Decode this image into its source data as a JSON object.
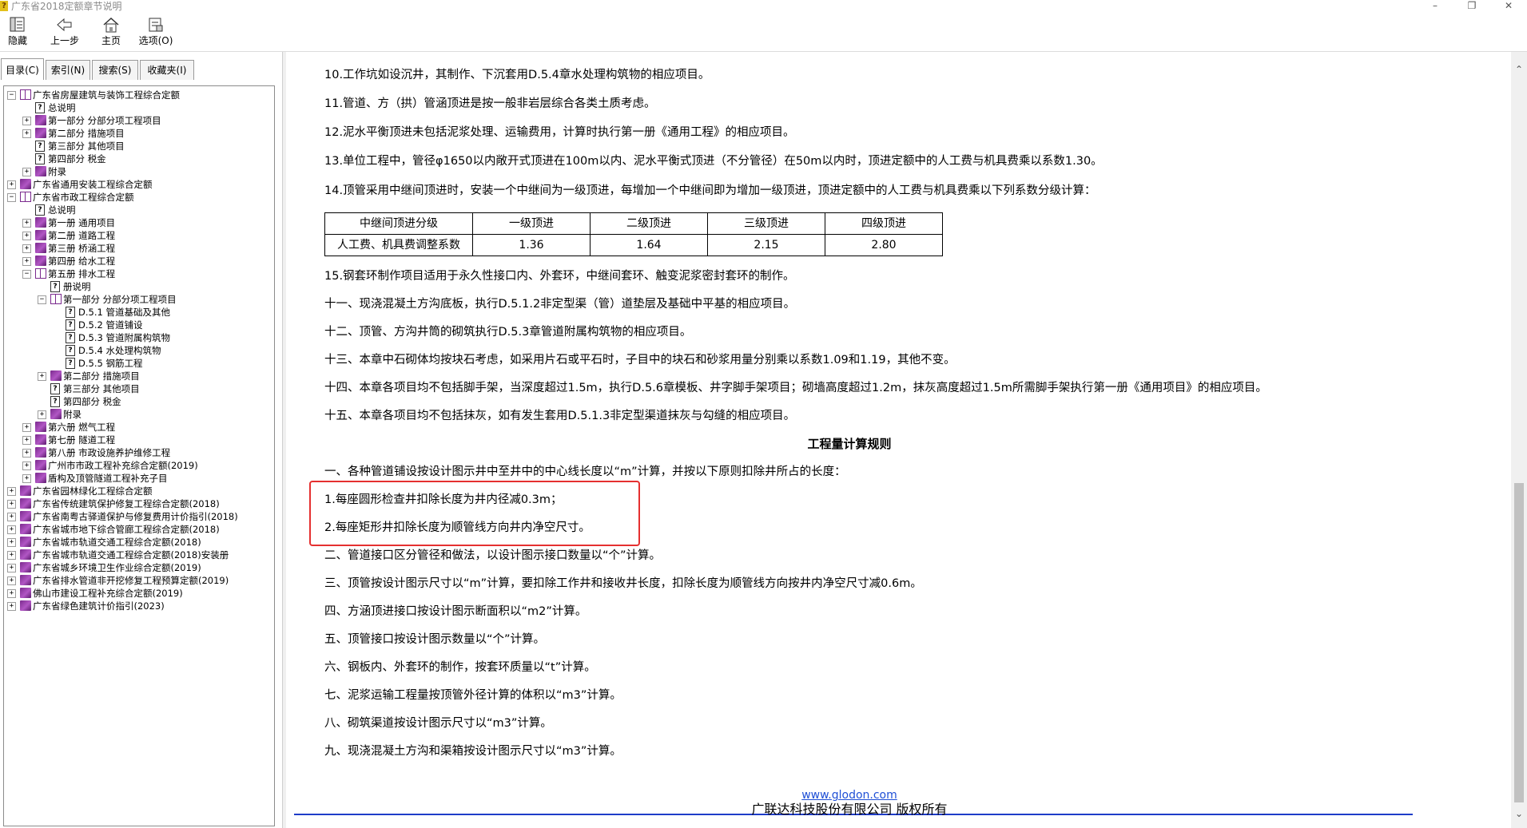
{
  "window": {
    "title": "广东省2018定额章节说明",
    "app_icon": "question-book-icon",
    "buttons": {
      "minimize": "–",
      "maximize": "❐",
      "close": "✕"
    }
  },
  "toolbar": {
    "items": [
      {
        "label": "隐藏",
        "icon": "hide-panel-icon"
      },
      {
        "label": "上一步",
        "icon": "back-arrow-icon"
      },
      {
        "label": "主页",
        "icon": "home-icon"
      },
      {
        "label": "选项(O)",
        "icon": "options-icon"
      }
    ]
  },
  "sidebar": {
    "tabs": [
      {
        "label": "目录(C)",
        "active": true
      },
      {
        "label": "索引(N)",
        "active": false
      },
      {
        "label": "搜索(S)",
        "active": false
      },
      {
        "label": "收藏夹(I)",
        "active": false
      }
    ],
    "tree": [
      {
        "label": "广东省房屋建筑与装饰工程综合定额",
        "level": 0,
        "icon": "open-book",
        "exp": "−"
      },
      {
        "label": "总说明",
        "level": 1,
        "icon": "page",
        "exp": ""
      },
      {
        "label": "第一部分 分部分项工程项目",
        "level": 1,
        "icon": "book",
        "exp": "+"
      },
      {
        "label": "第二部分 措施项目",
        "level": 1,
        "icon": "book",
        "exp": "+"
      },
      {
        "label": "第三部分 其他项目",
        "level": 1,
        "icon": "page",
        "exp": ""
      },
      {
        "label": "第四部分 税金",
        "level": 1,
        "icon": "page",
        "exp": ""
      },
      {
        "label": "附录",
        "level": 1,
        "icon": "book",
        "exp": "+"
      },
      {
        "label": "广东省通用安装工程综合定额",
        "level": 0,
        "icon": "book",
        "exp": "+"
      },
      {
        "label": "广东省市政工程综合定额",
        "level": 0,
        "icon": "open-book",
        "exp": "−"
      },
      {
        "label": "总说明",
        "level": 1,
        "icon": "page",
        "exp": ""
      },
      {
        "label": "第一册 通用项目",
        "level": 1,
        "icon": "book",
        "exp": "+"
      },
      {
        "label": "第二册 道路工程",
        "level": 1,
        "icon": "book",
        "exp": "+"
      },
      {
        "label": "第三册 桥涵工程",
        "level": 1,
        "icon": "book",
        "exp": "+"
      },
      {
        "label": "第四册 给水工程",
        "level": 1,
        "icon": "book",
        "exp": "+"
      },
      {
        "label": "第五册 排水工程",
        "level": 1,
        "icon": "open-book",
        "exp": "−"
      },
      {
        "label": "册说明",
        "level": 2,
        "icon": "page",
        "exp": ""
      },
      {
        "label": "第一部分 分部分项工程项目",
        "level": 2,
        "icon": "open-book",
        "exp": "−"
      },
      {
        "label": "D.5.1 管道基础及其他",
        "level": 3,
        "icon": "page",
        "exp": ""
      },
      {
        "label": "D.5.2 管道铺设",
        "level": 3,
        "icon": "page",
        "exp": ""
      },
      {
        "label": "D.5.3 管道附属构筑物",
        "level": 3,
        "icon": "page",
        "exp": ""
      },
      {
        "label": "D.5.4 水处理构筑物",
        "level": 3,
        "icon": "page",
        "exp": ""
      },
      {
        "label": "D.5.5 钢筋工程",
        "level": 3,
        "icon": "page",
        "exp": ""
      },
      {
        "label": "第二部分 措施项目",
        "level": 2,
        "icon": "book",
        "exp": "+"
      },
      {
        "label": "第三部分 其他项目",
        "level": 2,
        "icon": "page",
        "exp": ""
      },
      {
        "label": "第四部分 税金",
        "level": 2,
        "icon": "page",
        "exp": ""
      },
      {
        "label": "附录",
        "level": 2,
        "icon": "book",
        "exp": "+"
      },
      {
        "label": "第六册 燃气工程",
        "level": 1,
        "icon": "book",
        "exp": "+"
      },
      {
        "label": "第七册 隧道工程",
        "level": 1,
        "icon": "book",
        "exp": "+"
      },
      {
        "label": "第八册 市政设施养护维修工程",
        "level": 1,
        "icon": "book",
        "exp": "+"
      },
      {
        "label": "广州市市政工程补充综合定额(2019)",
        "level": 1,
        "icon": "book",
        "exp": "+"
      },
      {
        "label": "盾构及顶管隧道工程补充子目",
        "level": 1,
        "icon": "book",
        "exp": "+"
      },
      {
        "label": "广东省园林绿化工程综合定额",
        "level": 0,
        "icon": "book",
        "exp": "+"
      },
      {
        "label": "广东省传统建筑保护修复工程综合定额(2018)",
        "level": 0,
        "icon": "book",
        "exp": "+"
      },
      {
        "label": "广东省南粤古驿道保护与修复费用计价指引(2018)",
        "level": 0,
        "icon": "book",
        "exp": "+"
      },
      {
        "label": "广东省城市地下综合管廊工程综合定额(2018)",
        "level": 0,
        "icon": "book",
        "exp": "+"
      },
      {
        "label": "广东省城市轨道交通工程综合定额(2018)",
        "level": 0,
        "icon": "book",
        "exp": "+"
      },
      {
        "label": "广东省城市轨道交通工程综合定额(2018)安装册",
        "level": 0,
        "icon": "book",
        "exp": "+"
      },
      {
        "label": "广东省城乡环境卫生作业综合定额(2019)",
        "level": 0,
        "icon": "book",
        "exp": "+"
      },
      {
        "label": "广东省排水管道非开挖修复工程预算定额(2019)",
        "level": 0,
        "icon": "book",
        "exp": "+"
      },
      {
        "label": "佛山市建设工程补充综合定额(2019)",
        "level": 0,
        "icon": "book",
        "exp": "+"
      },
      {
        "label": "广东省绿色建筑计价指引(2023)",
        "level": 0,
        "icon": "book",
        "exp": "+"
      }
    ]
  },
  "content": {
    "lines_top": [
      "10.工作坑如设沉井，其制作、下沉套用D.5.4章水处理构筑物的相应项目。",
      "11.管道、方（拱）管涵顶进是按一般非岩层综合各类土质考虑。",
      "12.泥水平衡顶进未包括泥浆处理、运输费用，计算时执行第一册《通用工程》的相应项目。",
      "13.单位工程中，管径φ1650以内敞开式顶进在100m以内、泥水平衡式顶进（不分管径）在50m以内时，顶进定额中的人工费与机具费乘以系数1.30。",
      "14.顶管采用中继间顶进时，安装一个中继间为一级顶进，每增加一个中继间即为增加一级顶进，顶进定额中的人工费与机具费乘以下列系数分级计算："
    ],
    "table": {
      "headers": [
        "中继间顶进分级",
        "一级顶进",
        "二级顶进",
        "三级顶进",
        "四级顶进"
      ],
      "row": [
        "人工费、机具费调整系数",
        "1.36",
        "1.64",
        "2.15",
        "2.80"
      ]
    },
    "lines_mid": [
      "15.钢套环制作项目适用于永久性接口内、外套环，中继间套环、触变泥浆密封套环的制作。",
      "十一、现浇混凝土方沟底板，执行D.5.1.2非定型渠（管）道垫层及基础中平基的相应项目。",
      "十二、顶管、方沟井筒的砌筑执行D.5.3章管道附属构筑物的相应项目。",
      "十三、本章中石砌体均按块石考虑，如采用片石或平石时，子目中的块石和砂浆用量分别乘以系数1.09和1.19，其他不变。",
      "十四、本章各项目均不包括脚手架，当深度超过1.5m，执行D.5.6章模板、井字脚手架项目；砌墙高度超过1.2m，抹灰高度超过1.5m所需脚手架执行第一册《通用项目》的相应项目。",
      "十五、本章各项目均不包括抹灰，如有发生套用D.5.1.3非定型渠道抹灰与勾缝的相应项目。"
    ],
    "heading": "工程量计算规则",
    "lines_bottom": [
      "一、各种管道铺设按设计图示井中至井中的中心线长度以“m”计算，并按以下原则扣除井所占的长度：",
      "1.每座圆形检查井扣除长度为井内径减0.3m；",
      "2.每座矩形井扣除长度为顺管线方向井内净空尺寸。",
      "二、管道接口区分管径和做法，以设计图示接口数量以“个”计算。",
      "三、顶管按设计图示尺寸以“m”计算，要扣除工作井和接收井长度，扣除长度为顺管线方向按井内净空尺寸减0.6m。",
      "四、方涵顶进接口按设计图示断面积以“m2”计算。",
      "五、顶管接口按设计图示数量以“个”计算。",
      "六、钢板内、外套环的制作，按套环质量以“t”计算。",
      "七、泥浆运输工程量按顶管外径计算的体积以“m3”计算。",
      "八、砌筑渠道按设计图示尺寸以“m3”计算。",
      "九、现浇混凝土方沟和渠箱按设计图示尺寸以“m3”计算。"
    ],
    "footer_link": "www.glodon.com",
    "footer_copy": "广联达科技股份有限公司 版权所有"
  },
  "colors": {
    "highlight_box": "#e53030",
    "rule": "#1e3cc8",
    "link": "#1f4fd6",
    "book": "#7b2a8e"
  }
}
